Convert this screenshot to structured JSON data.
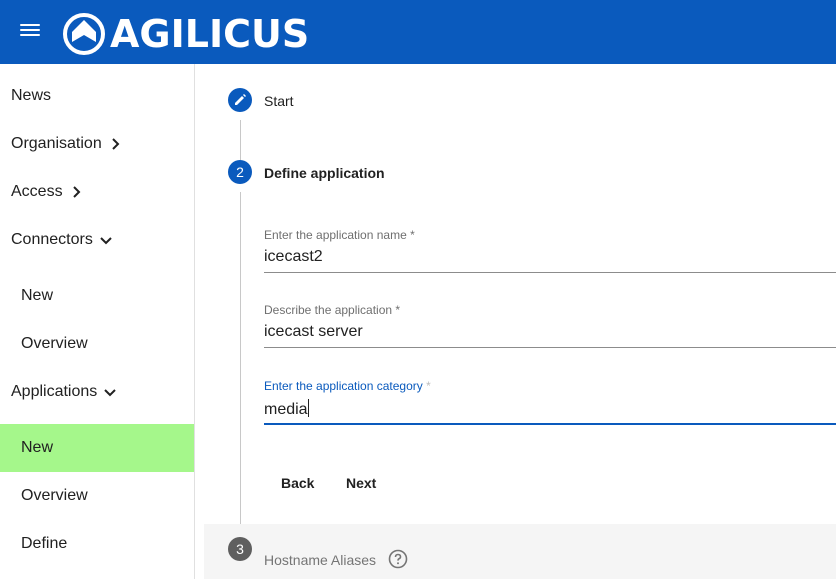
{
  "header": {
    "brand": "AGILICUS",
    "menu_icon": "menu-icon",
    "logo_icon": "agilicus-logo-icon",
    "color": "#0a5abd"
  },
  "sidebar": {
    "items": [
      {
        "label": "News",
        "level": "top",
        "expanded": null
      },
      {
        "label": "Organisation",
        "level": "top",
        "expanded": false
      },
      {
        "label": "Access",
        "level": "top",
        "expanded": false
      },
      {
        "label": "Connectors",
        "level": "top",
        "expanded": true
      },
      {
        "label": "New",
        "level": "sub"
      },
      {
        "label": "Overview",
        "level": "sub"
      },
      {
        "label": "Applications",
        "level": "top",
        "expanded": true
      },
      {
        "label": "New",
        "level": "sub",
        "active": true
      },
      {
        "label": "Overview",
        "level": "sub"
      },
      {
        "label": "Define",
        "level": "sub"
      }
    ],
    "active_color": "#a5f78b"
  },
  "stepper": {
    "step1": {
      "label": "Start",
      "icon": "edit-pencil-icon"
    },
    "step2": {
      "number": "2",
      "label": "Define application"
    },
    "step3": {
      "number": "3",
      "label": "Hostname Aliases",
      "icon": "help-circle-icon"
    }
  },
  "form": {
    "name": {
      "label": "Enter the application name",
      "required": "*",
      "value": "icecast2"
    },
    "description": {
      "label": "Describe the application",
      "required": "*",
      "value": "icecast server"
    },
    "category": {
      "label": "Enter the application category",
      "required": "*",
      "value": "media",
      "focused": true
    }
  },
  "buttons": {
    "back": "Back",
    "next": "Next"
  }
}
